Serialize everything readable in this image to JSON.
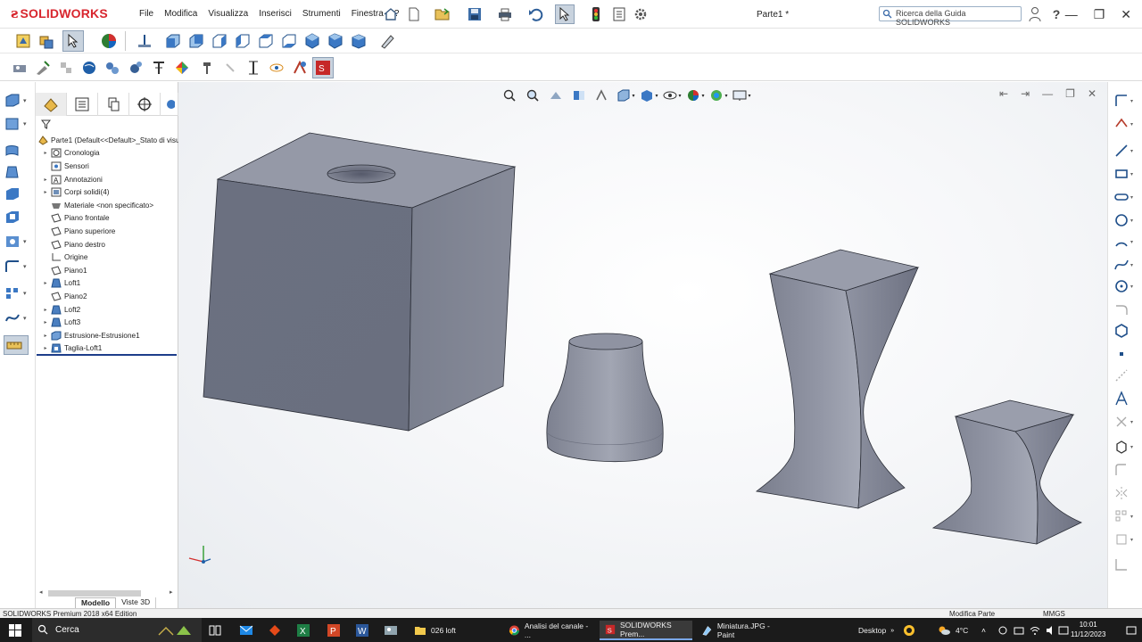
{
  "app": {
    "logo": "SOLIDWORKS",
    "menu": [
      "File",
      "Modifica",
      "Visualizza",
      "Inserisci",
      "Strumenti",
      "Finestra",
      "?"
    ],
    "document_title": "Parte1 *",
    "help_search_placeholder": "Ricerca della Guida SOLIDWORKS"
  },
  "feature_tree": {
    "root": "Parte1  (Default<<Default>_Stato di visu",
    "items": [
      {
        "label": "Cronologia",
        "icon": "history-folder-icon",
        "expandable": true
      },
      {
        "label": "Sensori",
        "icon": "sensor-folder-icon",
        "expandable": false
      },
      {
        "label": "Annotazioni",
        "icon": "annotations-icon",
        "expandable": true
      },
      {
        "label": "Corpi solidi(4)",
        "icon": "solid-bodies-icon",
        "expandable": true
      },
      {
        "label": "Materiale <non specificato>",
        "icon": "material-icon",
        "expandable": false
      },
      {
        "label": "Piano frontale",
        "icon": "plane-icon",
        "expandable": false
      },
      {
        "label": "Piano superiore",
        "icon": "plane-icon",
        "expandable": false
      },
      {
        "label": "Piano destro",
        "icon": "plane-icon",
        "expandable": false
      },
      {
        "label": "Origine",
        "icon": "origin-icon",
        "expandable": false
      },
      {
        "label": "Piano1",
        "icon": "plane-icon",
        "expandable": false
      },
      {
        "label": "Loft1",
        "icon": "loft-icon",
        "expandable": true
      },
      {
        "label": "Piano2",
        "icon": "plane-icon",
        "expandable": false
      },
      {
        "label": "Loft2",
        "icon": "loft-icon",
        "expandable": true
      },
      {
        "label": "Loft3",
        "icon": "loft-icon",
        "expandable": true
      },
      {
        "label": "Estrusione-Estrusione1",
        "icon": "extrude-icon",
        "expandable": true
      },
      {
        "label": "Taglia-Loft1",
        "icon": "cut-loft-icon",
        "expandable": true
      }
    ],
    "bottom_tabs": [
      "Modello",
      "Viste 3D"
    ]
  },
  "status": {
    "edition": "SOLIDWORKS Premium 2018 x64 Edition",
    "mode": "Modifica Parte",
    "units": "MMGS"
  },
  "taskbar": {
    "search_placeholder": "Cerca",
    "apps": [
      {
        "label": "026 loft",
        "icon": "folder-icon"
      },
      {
        "label": "Analisi del canale - ...",
        "icon": "chrome-icon"
      },
      {
        "label": "SOLIDWORKS Prem...",
        "icon": "solidworks-icon"
      },
      {
        "label": "Miniatura.JPG - Paint",
        "icon": "paint-icon"
      }
    ],
    "desktop": "Desktop",
    "weather": "4°C",
    "time": "10:01",
    "date": "11/12/2023"
  },
  "colors": {
    "brand": "#d8262e",
    "model_face_front": "#6f7483",
    "model_face_side": "#7d8291",
    "model_face_top": "#9599a7",
    "viewport_bg": "#f2f4f7",
    "taskbar_bg": "#1b1b1b"
  }
}
